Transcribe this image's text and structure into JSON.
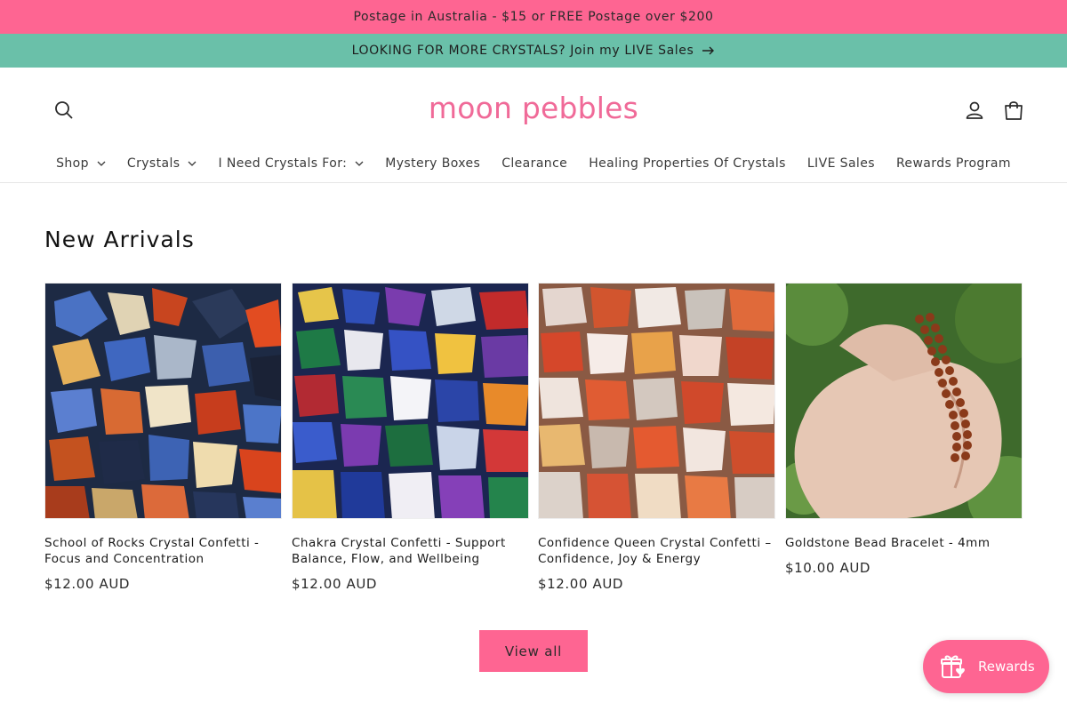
{
  "announcements": {
    "postage": "Postage in Australia - $15 or FREE Postage over $200",
    "live": "LOOKING FOR MORE CRYSTALS? Join my LIVE Sales"
  },
  "header": {
    "logo_text": "moon pebbles",
    "icons": {
      "search": "search-icon",
      "account": "account-icon",
      "cart": "cart-icon"
    }
  },
  "nav": {
    "items": [
      {
        "label": "Shop",
        "has_dropdown": true
      },
      {
        "label": "Crystals",
        "has_dropdown": true
      },
      {
        "label": "I Need Crystals For:",
        "has_dropdown": true
      },
      {
        "label": "Mystery Boxes",
        "has_dropdown": false
      },
      {
        "label": "Clearance",
        "has_dropdown": false
      },
      {
        "label": "Healing Properties Of Crystals",
        "has_dropdown": false
      },
      {
        "label": "LIVE Sales",
        "has_dropdown": false
      },
      {
        "label": "Rewards Program",
        "has_dropdown": false
      }
    ]
  },
  "new_arrivals": {
    "title": "New Arrivals",
    "products": [
      {
        "title": "School of Rocks Crystal Confetti - Focus and Concentration",
        "price": "$12.00 AUD"
      },
      {
        "title": "Chakra Crystal Confetti - Support Balance, Flow, and Wellbeing",
        "price": "$12.00 AUD"
      },
      {
        "title": "Confidence Queen Crystal Confetti – Confidence, Joy & Energy",
        "price": "$12.00 AUD"
      },
      {
        "title": "Goldstone Bead Bracelet - 4mm",
        "price": "$10.00 AUD"
      }
    ],
    "view_all_label": "View all"
  },
  "rewards_widget": {
    "label": "Rewards",
    "icon": "gift-heart-icon"
  },
  "colors": {
    "pink": "#fe6592",
    "teal": "#6ac0a9",
    "logo_pink": "#f06a98"
  }
}
